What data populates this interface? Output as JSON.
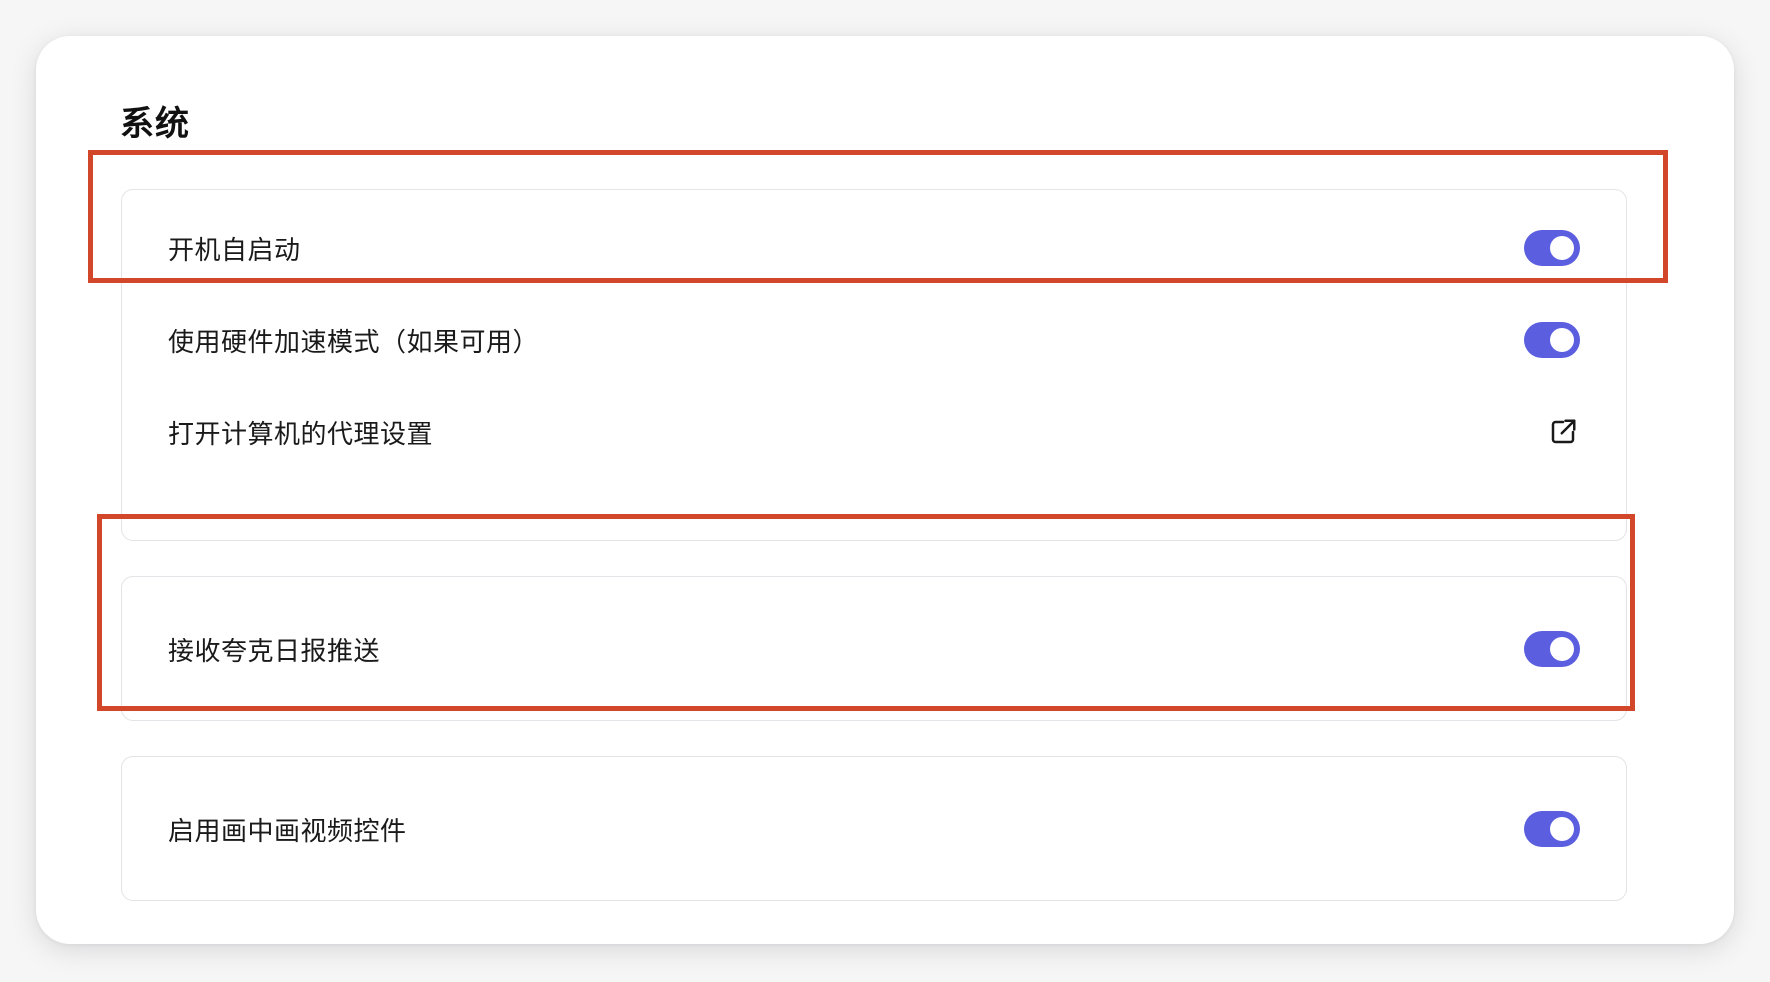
{
  "section": {
    "title": "系统"
  },
  "card1": {
    "rows": [
      {
        "label": "开机自启动",
        "control": "toggle",
        "value": true
      },
      {
        "label": "使用硬件加速模式（如果可用）",
        "control": "toggle",
        "value": true
      },
      {
        "label": "打开计算机的代理设置",
        "control": "external-link-icon"
      }
    ]
  },
  "card2": {
    "rows": [
      {
        "label": "接收夸克日报推送",
        "control": "toggle",
        "value": true
      }
    ]
  },
  "card3": {
    "rows": [
      {
        "label": "启用画中画视频控件",
        "control": "toggle",
        "value": true
      }
    ]
  },
  "colors": {
    "toggle_on": "#5b5fdf",
    "highlight_box": "#d2462a",
    "card_border": "#e4e4e8"
  }
}
